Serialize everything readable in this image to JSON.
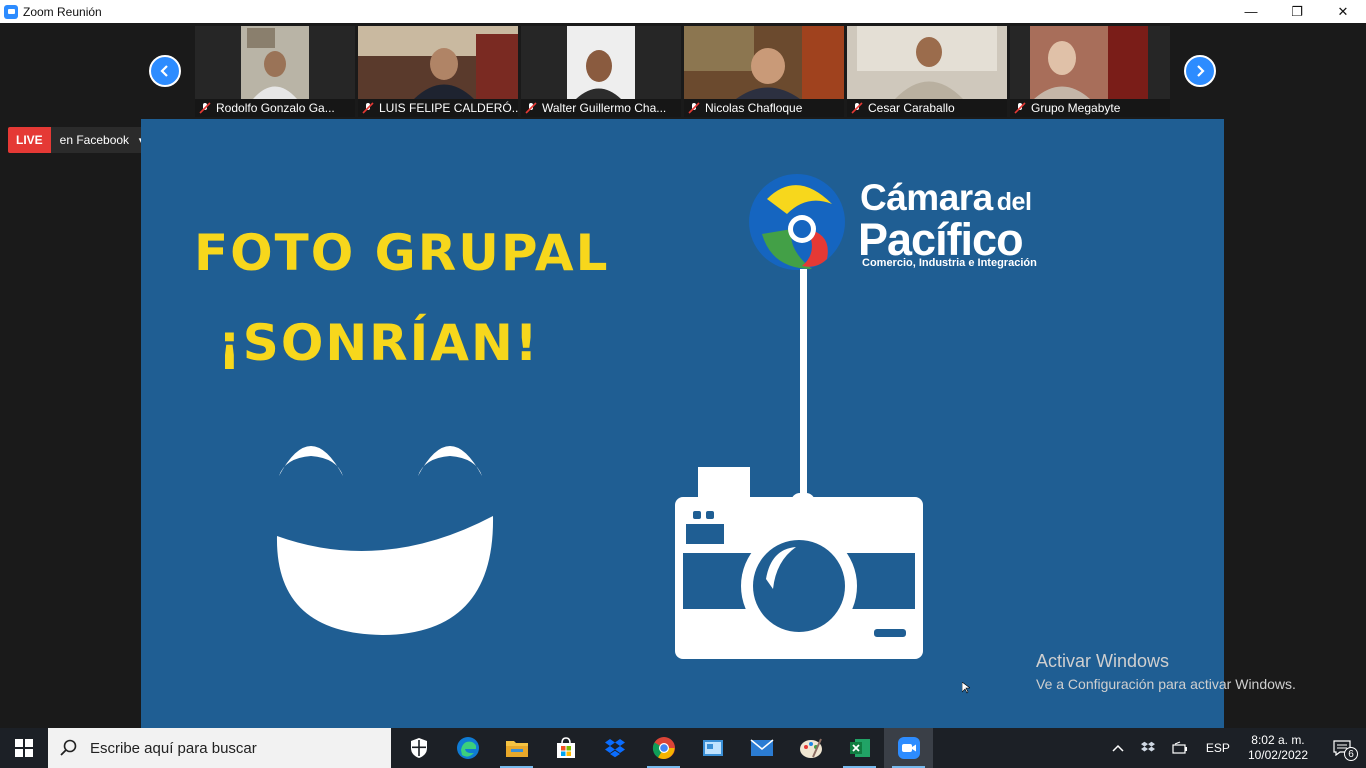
{
  "window": {
    "title": "Zoom Reunión",
    "minimize": "—",
    "restore": "❐",
    "close": "✕"
  },
  "participants": [
    {
      "name": "Rodolfo Gonzalo Ga...",
      "mic": "muted"
    },
    {
      "name": "LUIS FELIPE CALDERÓ...",
      "mic": "muted"
    },
    {
      "name": "Walter Guillermo Cha...",
      "mic": "muted"
    },
    {
      "name": "Nicolas Chafloque",
      "mic": "muted"
    },
    {
      "name": "Cesar Caraballo",
      "mic": "muted"
    },
    {
      "name": "Grupo Megabyte",
      "mic": "muted"
    }
  ],
  "live": {
    "badge": "LIVE",
    "platform": "en Facebook",
    "caret": "▼"
  },
  "slide": {
    "headline1": "FOTO GRUPAL",
    "headline2": "¡SONRÍAN!",
    "brand_line1": "Cámara",
    "brand_line1_small": "del",
    "brand_line2": "Pacífico",
    "brand_tagline": "Comercio, Industria e Integración",
    "background_color": "#1f5e93",
    "headline_color": "#f7d71c"
  },
  "watermark": {
    "line1": "Activar Windows",
    "line2": "Ve a Configuración para activar Windows."
  },
  "taskbar": {
    "search_placeholder": "Escribe aquí para buscar",
    "apps": [
      "security-icon",
      "edge-icon",
      "file-explorer-icon",
      "store-icon",
      "dropbox-icon",
      "chrome-icon",
      "control-panel-icon",
      "mail-icon",
      "paint-icon",
      "excel-icon",
      "zoom-icon"
    ],
    "language": "ESP",
    "time": "8:02 a. m.",
    "date": "10/02/2022",
    "notifications": "6"
  }
}
